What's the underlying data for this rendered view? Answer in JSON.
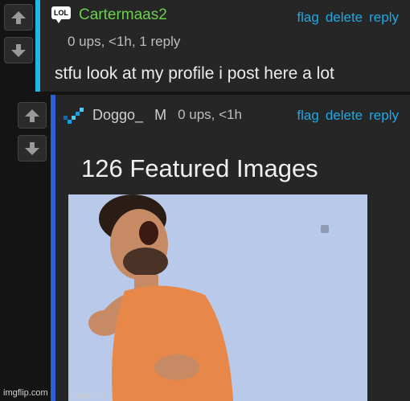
{
  "comment1": {
    "username": "Cartermaas2",
    "badge_text": "LOL",
    "meta": "0 ups, <1h, 1 reply",
    "body": "stfu look at my profile i post here a lot",
    "actions": [
      "flag",
      "delete",
      "reply"
    ],
    "accent_color": "#1eb7e6"
  },
  "comment2": {
    "username": "Doggo_",
    "gender": "M",
    "meta": "0 ups, <1h",
    "actions": [
      "flag",
      "delete",
      "reply"
    ],
    "accent_color": "#2f5fd6",
    "embedded": {
      "title": "126 Featured Images",
      "image_watermark": "imgflip.com"
    }
  },
  "watermark": "imgflip.com",
  "icons": {
    "upvote": "arrow-up-icon",
    "downvote": "arrow-down-icon",
    "badge": "lol-speech-bubble-icon",
    "user_icon": "pixel-diamond-icon"
  },
  "colors": {
    "link": "#1fa8e6",
    "username_green": "#6cd04e",
    "background": "#141414"
  }
}
